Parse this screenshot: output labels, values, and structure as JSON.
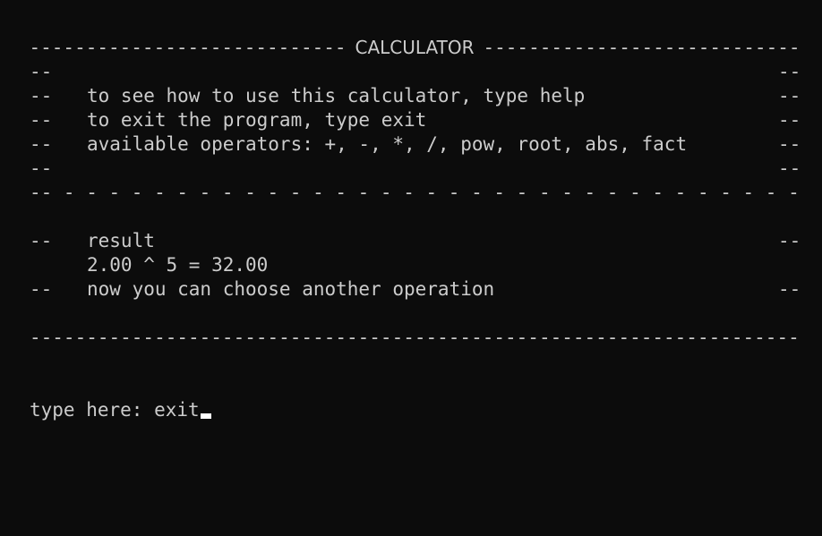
{
  "header": {
    "title": "CALCULATOR",
    "rule_left": "-------------------------------------------------",
    "rule_right": "-------------------------------------------------"
  },
  "border": {
    "marker": "--",
    "dashed_separator": "-- - - - - - - - - - - - - - - - - - - - - - - - - - - - - - - - - - - - - - - - - - - - - - - - -",
    "bottom_rule": "--------------------------------------------------------------------------------------------------------"
  },
  "help_lines": [
    "to see how to use this calculator, type help",
    "to exit the program, type exit",
    "available operators: +, -, *, /, pow, root, abs, fact"
  ],
  "result": {
    "label": "result",
    "expression": "2.00 ^ 5 = 32.00",
    "next_hint": "now you can choose another operation"
  },
  "prompt": {
    "label": "type here: ",
    "input_value": "exit"
  }
}
